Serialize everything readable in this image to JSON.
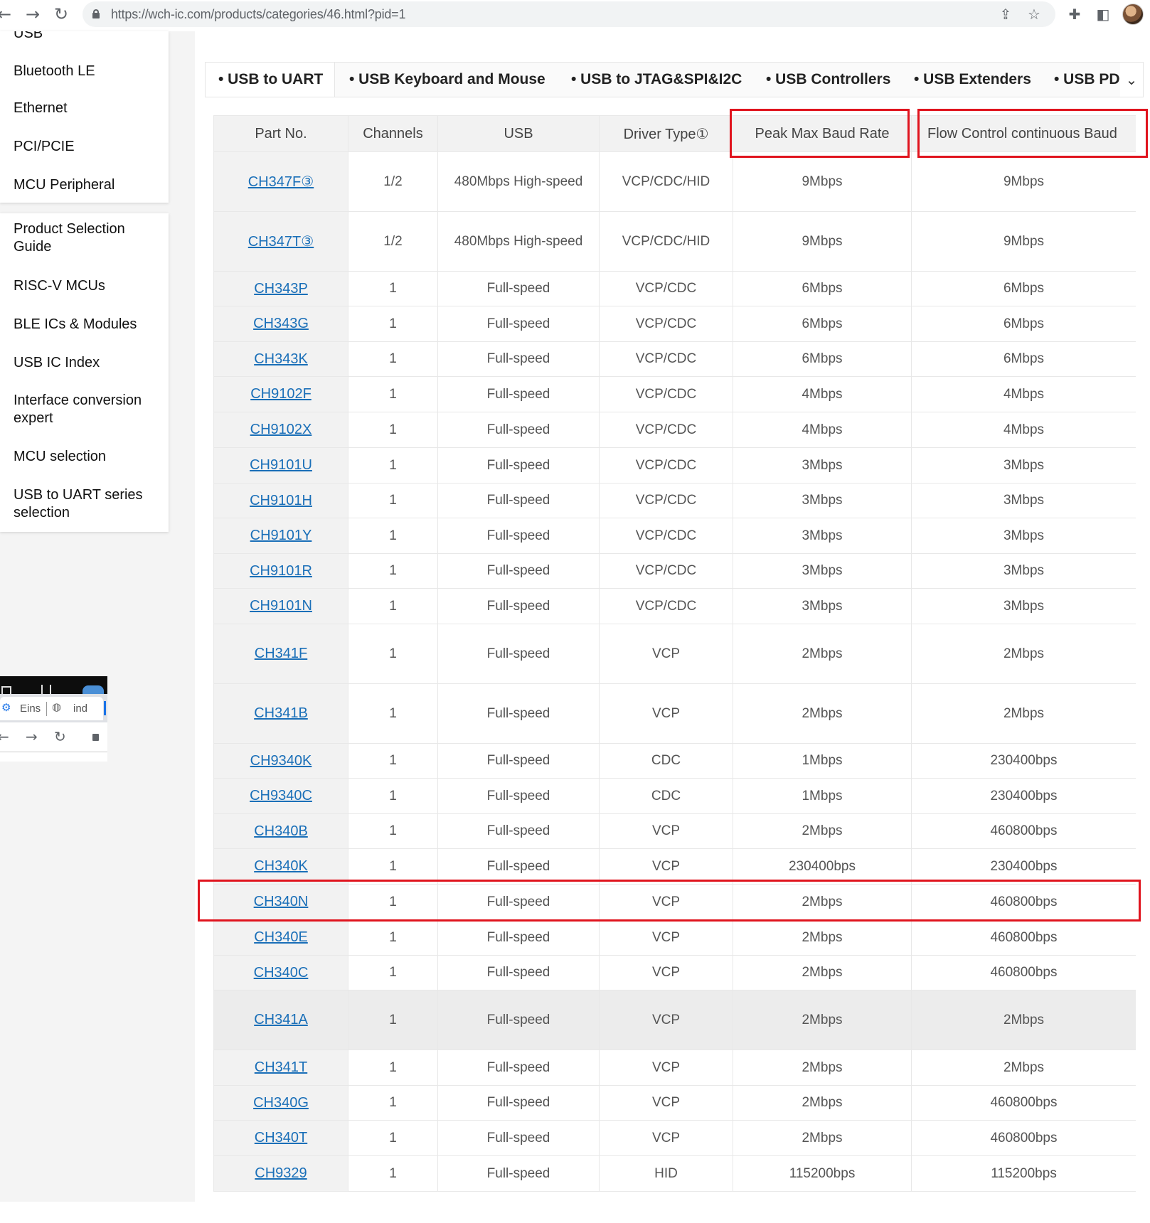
{
  "browser": {
    "url": "https://wch-ic.com/products/categories/46.html?pid=1"
  },
  "sidebar": {
    "group1": [
      "USB",
      "Bluetooth LE",
      "Ethernet",
      "PCI/PCIE",
      "MCU Peripheral"
    ],
    "group2": [
      "Product Selection Guide",
      "RISC-V MCUs",
      "BLE ICs & Modules",
      "USB IC Index",
      "Interface conversion expert",
      "MCU selection",
      "USB to UART series selection"
    ]
  },
  "mini_screenshot": {
    "tab1": "Eins",
    "tab2": "ind"
  },
  "tabs": [
    "• USB to UART",
    "• USB Keyboard and Mouse",
    "• USB to JTAG&SPI&I2C",
    "• USB Controllers",
    "• USB Extenders",
    "• USB PD"
  ],
  "table": {
    "headers": [
      "Part No.",
      "Channels",
      "USB",
      "Driver Type①",
      "Peak Max Baud Rate",
      "Flow Control continuous Baud"
    ],
    "rows": [
      [
        "CH347F③",
        "1/2",
        "480Mbps High-speed",
        "VCP/CDC/HID",
        "9Mbps",
        "9Mbps"
      ],
      [
        "CH347T③",
        "1/2",
        "480Mbps High-speed",
        "VCP/CDC/HID",
        "9Mbps",
        "9Mbps"
      ],
      [
        "CH343P",
        "1",
        "Full-speed",
        "VCP/CDC",
        "6Mbps",
        "6Mbps"
      ],
      [
        "CH343G",
        "1",
        "Full-speed",
        "VCP/CDC",
        "6Mbps",
        "6Mbps"
      ],
      [
        "CH343K",
        "1",
        "Full-speed",
        "VCP/CDC",
        "6Mbps",
        "6Mbps"
      ],
      [
        "CH9102F",
        "1",
        "Full-speed",
        "VCP/CDC",
        "4Mbps",
        "4Mbps"
      ],
      [
        "CH9102X",
        "1",
        "Full-speed",
        "VCP/CDC",
        "4Mbps",
        "4Mbps"
      ],
      [
        "CH9101U",
        "1",
        "Full-speed",
        "VCP/CDC",
        "3Mbps",
        "3Mbps"
      ],
      [
        "CH9101H",
        "1",
        "Full-speed",
        "VCP/CDC",
        "3Mbps",
        "3Mbps"
      ],
      [
        "CH9101Y",
        "1",
        "Full-speed",
        "VCP/CDC",
        "3Mbps",
        "3Mbps"
      ],
      [
        "CH9101R",
        "1",
        "Full-speed",
        "VCP/CDC",
        "3Mbps",
        "3Mbps"
      ],
      [
        "CH9101N",
        "1",
        "Full-speed",
        "VCP/CDC",
        "3Mbps",
        "3Mbps"
      ],
      [
        "CH341F",
        "1",
        "Full-speed",
        "VCP",
        "2Mbps",
        "2Mbps"
      ],
      [
        "CH341B",
        "1",
        "Full-speed",
        "VCP",
        "2Mbps",
        "2Mbps"
      ],
      [
        "CH9340K",
        "1",
        "Full-speed",
        "CDC",
        "1Mbps",
        "230400bps"
      ],
      [
        "CH9340C",
        "1",
        "Full-speed",
        "CDC",
        "1Mbps",
        "230400bps"
      ],
      [
        "CH340B",
        "1",
        "Full-speed",
        "VCP",
        "2Mbps",
        "460800bps"
      ],
      [
        "CH340K",
        "1",
        "Full-speed",
        "VCP",
        "230400bps",
        "230400bps"
      ],
      [
        "CH340N",
        "1",
        "Full-speed",
        "VCP",
        "2Mbps",
        "460800bps"
      ],
      [
        "CH340E",
        "1",
        "Full-speed",
        "VCP",
        "2Mbps",
        "460800bps"
      ],
      [
        "CH340C",
        "1",
        "Full-speed",
        "VCP",
        "2Mbps",
        "460800bps"
      ],
      [
        "CH341A",
        "1",
        "Full-speed",
        "VCP",
        "2Mbps",
        "2Mbps"
      ],
      [
        "CH341T",
        "1",
        "Full-speed",
        "VCP",
        "2Mbps",
        "2Mbps"
      ],
      [
        "CH340G",
        "1",
        "Full-speed",
        "VCP",
        "2Mbps",
        "460800bps"
      ],
      [
        "CH340T",
        "1",
        "Full-speed",
        "VCP",
        "2Mbps",
        "460800bps"
      ],
      [
        "CH9329",
        "1",
        "Full-speed",
        "HID",
        "115200bps",
        "115200bps"
      ]
    ]
  },
  "colors": {
    "link": "#1a6fb8",
    "annotation": "#e0141e"
  }
}
